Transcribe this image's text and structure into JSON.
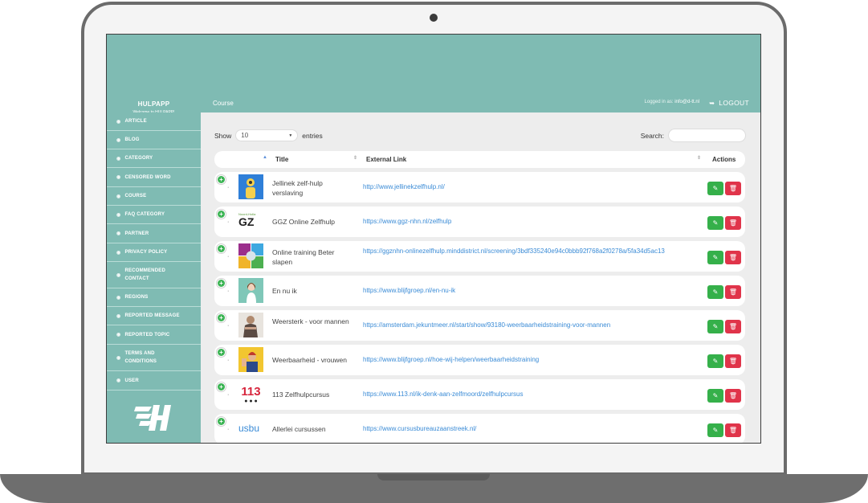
{
  "app": {
    "brand_name": "HULPAPP",
    "brand_sub": "Welcome to HULPAPP!",
    "page_heading": "Course",
    "logged_in_label": "Logged in as:",
    "logged_in_user": "info@d-tt.nl",
    "logout_label": "LOGOUT"
  },
  "sidebar": {
    "items": [
      {
        "label": "ARTICLE"
      },
      {
        "label": "BLOG"
      },
      {
        "label": "CATEGORY"
      },
      {
        "label": "CENSORED WORD"
      },
      {
        "label": "COURSE"
      },
      {
        "label": "FAQ CATEGORY"
      },
      {
        "label": "PARTNER"
      },
      {
        "label": "PRIVACY POLICY"
      },
      {
        "label": "RECOMMENDED CONTACT"
      },
      {
        "label": "REGIONS"
      },
      {
        "label": "REPORTED MESSAGE"
      },
      {
        "label": "REPORTED TOPIC"
      },
      {
        "label": "TERMS AND CONDITIONS"
      },
      {
        "label": "USER"
      }
    ]
  },
  "table_controls": {
    "show_label": "Show",
    "entries_value": "10",
    "entries_label": "entries",
    "search_label": "Search:"
  },
  "table": {
    "headers": {
      "title": "Title",
      "link": "External Link",
      "actions": "Actions"
    },
    "rows": [
      {
        "title": "Jellinek zelf-hulp verslaving",
        "link": "http://www.jellinekzelfhulp.nl/"
      },
      {
        "title": "GGZ Online Zelfhulp",
        "link": "https://www.ggz-nhn.nl/zelfhulp"
      },
      {
        "title": "Online training Beter slapen",
        "link": "https://ggznhn-onlinezelfhulp.minddistrict.nl/screening/3bdf335240e94c0bbb92f768a2f0278a/5fa34d5ac13"
      },
      {
        "title": "En nu ik",
        "link": "https://www.blijfgroep.nl/en-nu-ik"
      },
      {
        "title": "Weersterk - voor mannen",
        "link": "https://amsterdam.jekuntmeer.nl/start/show/93180-weerbaarheidstraining-voor-mannen"
      },
      {
        "title": "Weerbaarheid - vrouwen",
        "link": "https://www.blijfgroep.nl/hoe-wij-helpen/weerbaarheidstraining"
      },
      {
        "title": "113 Zelfhulpcursus",
        "link": "https://www.113.nl/ik-denk-aan-zelfmoord/zelfhulpcursus"
      },
      {
        "title": "Allerlei cursussen",
        "link": "https://www.cursusbureauzaanstreek.nl/"
      }
    ]
  },
  "thumb_text": {
    "ggz_caption": "Noord-Holla",
    "ggz_letters": "GZ",
    "num_113": "113",
    "usbu": "usbu"
  },
  "colors": {
    "teal": "#7fbbb3",
    "edit_green": "#35b04a",
    "delete_red": "#e0344a",
    "link_blue": "#3a8bd6"
  }
}
